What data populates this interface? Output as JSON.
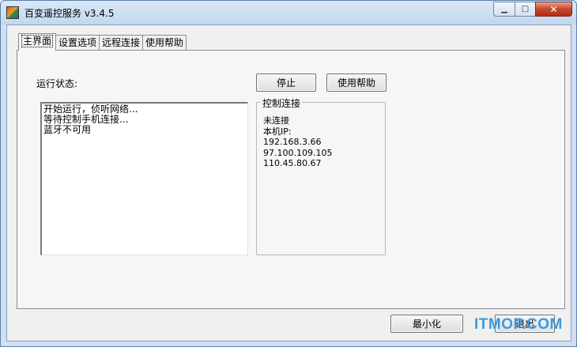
{
  "window": {
    "title": "百变遥控服务 v3.4.5"
  },
  "window_buttons": {
    "minimize": "▁",
    "maximize": "□",
    "close": "✕"
  },
  "tabs": [
    {
      "label": "主界面",
      "active": true
    },
    {
      "label": "设置选项",
      "active": false
    },
    {
      "label": "远程连接",
      "active": false
    },
    {
      "label": "使用帮助",
      "active": false
    }
  ],
  "main": {
    "run_status_label": "运行状态:",
    "stop_label": "停止",
    "help_label": "使用帮助",
    "log_lines": [
      "开始运行，侦听网络...",
      "等待控制手机连接...",
      "蓝牙不可用"
    ],
    "control_group": {
      "title": "控制连接",
      "status": "未连接",
      "ip_label": "本机IP:",
      "ips": [
        "192.168.3.66",
        "97.100.109.105",
        "110.45.80.67"
      ]
    }
  },
  "footer": {
    "minimize_label": "最小化",
    "exit_label": "退出"
  },
  "watermark": "ITMOP.COM"
}
